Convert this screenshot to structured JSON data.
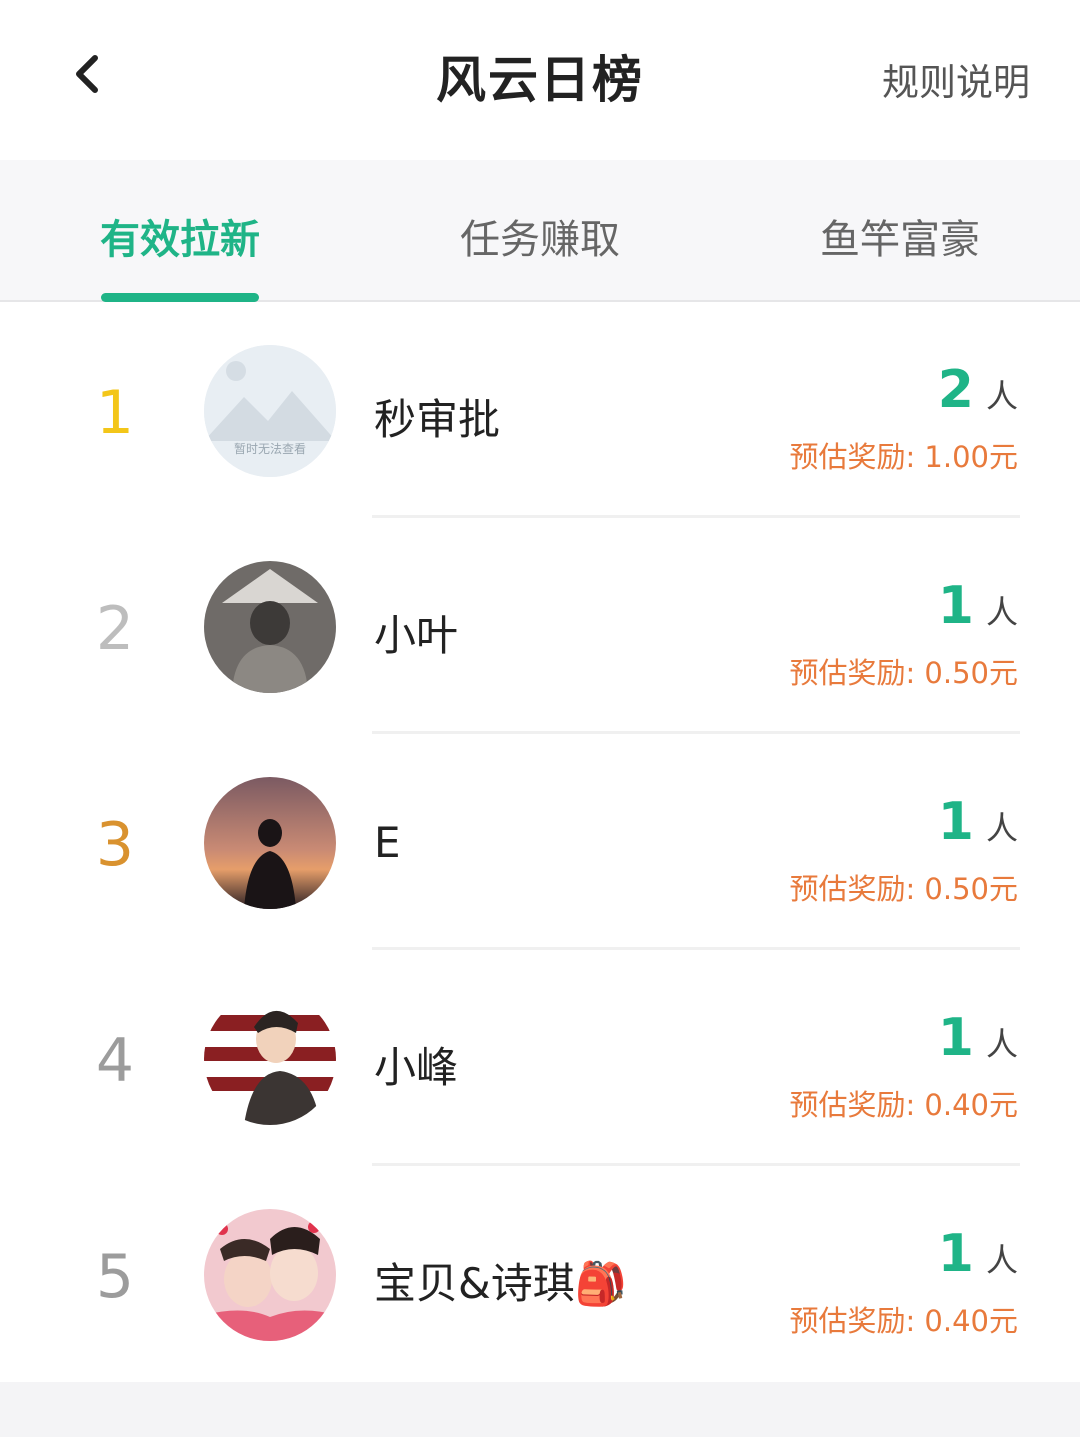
{
  "header": {
    "title": "风云日榜",
    "rules_label": "规则说明"
  },
  "tabs": [
    {
      "label": "有效拉新",
      "active": true
    },
    {
      "label": "任务赚取",
      "active": false
    },
    {
      "label": "鱼竿富豪",
      "active": false
    }
  ],
  "placeholder_text": "暂时无法查看",
  "rows": [
    {
      "rank": "1",
      "rank_color": "#f3c619",
      "name": "秒审批",
      "count": "2",
      "unit": "人",
      "reward": "预估奖励: 1.00元"
    },
    {
      "rank": "2",
      "rank_color": "#bdbdbd",
      "name": "小叶",
      "count": "1",
      "unit": "人",
      "reward": "预估奖励: 0.50元"
    },
    {
      "rank": "3",
      "rank_color": "#d9922f",
      "name": "E",
      "count": "1",
      "unit": "人",
      "reward": "预估奖励: 0.50元"
    },
    {
      "rank": "4",
      "rank_color": "#9c9c9c",
      "name": "小峰",
      "count": "1",
      "unit": "人",
      "reward": "预估奖励: 0.40元"
    },
    {
      "rank": "5",
      "rank_color": "#9c9c9c",
      "name": "宝贝&诗琪🎒",
      "count": "1",
      "unit": "人",
      "reward": "预估奖励: 0.40元"
    }
  ],
  "colors": {
    "accent": "#1fb487",
    "reward": "#e87a3c"
  }
}
